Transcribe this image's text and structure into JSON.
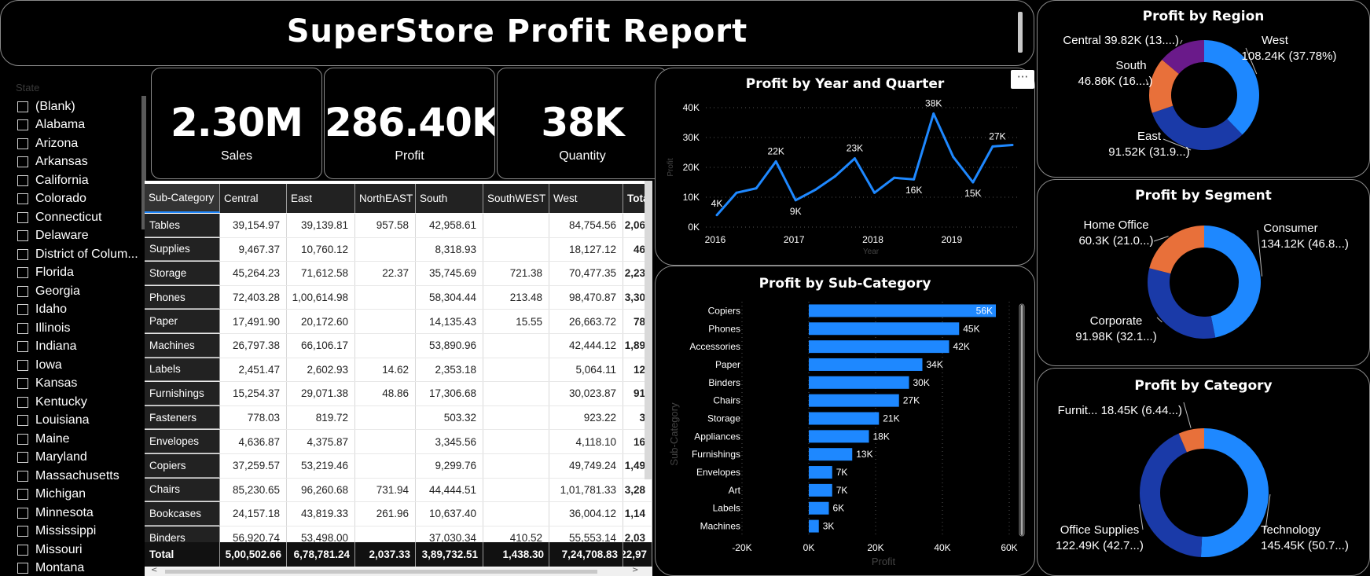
{
  "title": "SuperStore Profit Report",
  "slicer": {
    "header": "State",
    "items": [
      "(Blank)",
      "Alabama",
      "Arizona",
      "Arkansas",
      "California",
      "Colorado",
      "Connecticut",
      "Delaware",
      "District of Colum...",
      "Florida",
      "Georgia",
      "Idaho",
      "Illinois",
      "Indiana",
      "Iowa",
      "Kansas",
      "Kentucky",
      "Louisiana",
      "Maine",
      "Maryland",
      "Massachusetts",
      "Michigan",
      "Minnesota",
      "Mississippi",
      "Missouri",
      "Montana"
    ]
  },
  "kpis": {
    "sales": {
      "value": "2.30M",
      "label": "Sales"
    },
    "profit": {
      "value": "286.40K",
      "label": "Profit"
    },
    "quantity": {
      "value": "38K",
      "label": "Quantity"
    }
  },
  "matrix": {
    "columns": [
      "Sub-Category",
      "Central",
      "East",
      "NorthEAST",
      "South",
      "SouthWEST",
      "West",
      "Total"
    ],
    "rows": [
      [
        "Tables",
        "39,154.97",
        "39,139.81",
        "957.58",
        "42,958.61",
        "",
        "84,754.56",
        "2,06"
      ],
      [
        "Supplies",
        "9,467.37",
        "10,760.12",
        "",
        "8,318.93",
        "",
        "18,127.12",
        "46"
      ],
      [
        "Storage",
        "45,264.23",
        "71,612.58",
        "22.37",
        "35,745.69",
        "721.38",
        "70,477.35",
        "2,23"
      ],
      [
        "Phones",
        "72,403.28",
        "1,00,614.98",
        "",
        "58,304.44",
        "213.48",
        "98,470.87",
        "3,30"
      ],
      [
        "Paper",
        "17,491.90",
        "20,172.60",
        "",
        "14,135.43",
        "15.55",
        "26,663.72",
        "78"
      ],
      [
        "Machines",
        "26,797.38",
        "66,106.17",
        "",
        "53,890.96",
        "",
        "42,444.12",
        "1,89"
      ],
      [
        "Labels",
        "2,451.47",
        "2,602.93",
        "14.62",
        "2,353.18",
        "",
        "5,064.11",
        "12"
      ],
      [
        "Furnishings",
        "15,254.37",
        "29,071.38",
        "48.86",
        "17,306.68",
        "",
        "30,023.87",
        "91"
      ],
      [
        "Fasteners",
        "778.03",
        "819.72",
        "",
        "503.32",
        "",
        "923.22",
        "3"
      ],
      [
        "Envelopes",
        "4,636.87",
        "4,375.87",
        "",
        "3,345.56",
        "",
        "4,118.10",
        "16"
      ],
      [
        "Copiers",
        "37,259.57",
        "53,219.46",
        "",
        "9,299.76",
        "",
        "49,749.24",
        "1,49"
      ],
      [
        "Chairs",
        "85,230.65",
        "96,260.68",
        "731.94",
        "44,444.51",
        "",
        "1,01,781.33",
        "3,28"
      ],
      [
        "Bookcases",
        "24,157.18",
        "43,819.33",
        "261.96",
        "10,637.40",
        "",
        "36,004.12",
        "1,14"
      ],
      [
        "Binders",
        "56,920.74",
        "53,498.00",
        "",
        "37,030.34",
        "410.52",
        "55,553.14",
        "2,03"
      ]
    ],
    "total": [
      "Total",
      "5,00,502.66",
      "6,78,781.24",
      "2,037.33",
      "3,89,732.51",
      "1,438.30",
      "7,24,708.83",
      "22,97"
    ]
  },
  "more_options": "···",
  "chart_data": [
    {
      "type": "line",
      "title": "Profit by Year and Quarter",
      "xlabel": "Year",
      "ylabel": "Profit",
      "x_ticks": [
        "2016",
        "2017",
        "2018",
        "2019"
      ],
      "y_ticks": [
        "0K",
        "10K",
        "20K",
        "30K",
        "40K"
      ],
      "ylim": [
        0,
        40000
      ],
      "x": [
        "2016 Q1",
        "2016 Q2",
        "2016 Q3",
        "2016 Q4",
        "2017 Q1",
        "2017 Q2",
        "2017 Q3",
        "2017 Q4",
        "2018 Q1",
        "2018 Q2",
        "2018 Q3",
        "2018 Q4",
        "2019 Q1",
        "2019 Q2",
        "2019 Q3",
        "2019 Q4"
      ],
      "values": [
        4000,
        11500,
        13000,
        22000,
        9000,
        12500,
        17000,
        23000,
        11500,
        16500,
        16000,
        38000,
        23500,
        15000,
        27000,
        27500
      ],
      "data_labels": [
        "4K",
        "",
        "",
        "22K",
        "9K",
        "",
        "",
        "23K",
        "",
        "",
        "16K",
        "38K",
        "",
        "15K",
        "27K",
        ""
      ],
      "color": "#1e88ff"
    },
    {
      "type": "bar",
      "orientation": "horizontal",
      "title": "Profit by Sub-Category",
      "xlabel": "Profit",
      "ylabel": "Sub-Category",
      "x_ticks": [
        "-20K",
        "0K",
        "20K",
        "40K",
        "60K"
      ],
      "xlim": [
        -20000,
        60000
      ],
      "categories": [
        "Copiers",
        "Phones",
        "Accessories",
        "Paper",
        "Binders",
        "Chairs",
        "Storage",
        "Appliances",
        "Furnishings",
        "Envelopes",
        "Art",
        "Labels",
        "Machines"
      ],
      "values": [
        56000,
        45000,
        42000,
        34000,
        30000,
        27000,
        21000,
        18000,
        13000,
        7000,
        7000,
        6000,
        3000
      ],
      "data_labels": [
        "56K",
        "45K",
        "42K",
        "34K",
        "30K",
        "27K",
        "21K",
        "18K",
        "13K",
        "7K",
        "7K",
        "6K",
        "3K"
      ],
      "color": "#1e88ff"
    },
    {
      "type": "pie",
      "donut": true,
      "title": "Profit by Region",
      "slices": [
        {
          "name": "West",
          "value": 37.78,
          "label": "108.24K (37.78%)",
          "color": "#1e88ff"
        },
        {
          "name": "East",
          "value": 31.95,
          "label": "91.52K (31.9...)",
          "color": "#1a3aa8"
        },
        {
          "name": "South",
          "value": 16.36,
          "label": "46.86K (16....)",
          "color": "#e8703a"
        },
        {
          "name": "Central",
          "value": 13.9,
          "label": "39.82K (13....)",
          "color": "#6a1a8a"
        }
      ]
    },
    {
      "type": "pie",
      "donut": true,
      "title": "Profit by Segment",
      "slices": [
        {
          "name": "Consumer",
          "value": 46.84,
          "label": "134.12K (46.8...)",
          "color": "#1e88ff"
        },
        {
          "name": "Corporate",
          "value": 32.12,
          "label": "91.98K (32.1...)",
          "color": "#1a3aa8"
        },
        {
          "name": "Home Office",
          "value": 21.05,
          "label": "60.3K (21.0...)",
          "color": "#e8703a"
        }
      ]
    },
    {
      "type": "pie",
      "donut": true,
      "title": "Profit by Category",
      "slices": [
        {
          "name": "Technology",
          "value": 50.79,
          "label": "145.45K (50.7...)",
          "color": "#1e88ff"
        },
        {
          "name": "Office Supplies",
          "value": 42.77,
          "label": "122.49K (42.7...)",
          "color": "#1a3aa8"
        },
        {
          "name": "Furnit...",
          "value": 6.44,
          "label": "18.45K (6.44...)",
          "color": "#e8703a"
        }
      ]
    }
  ]
}
